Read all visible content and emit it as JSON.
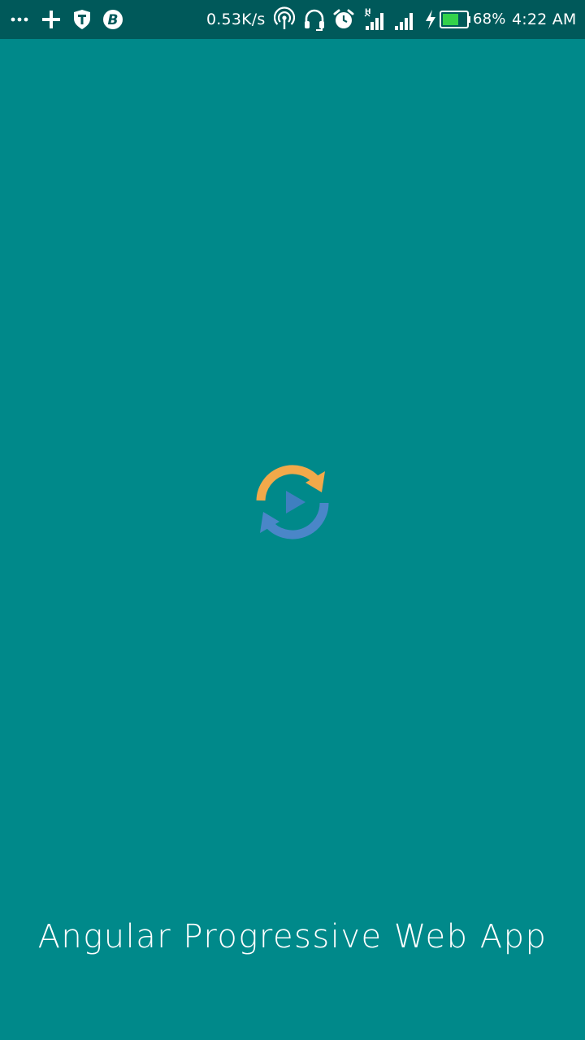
{
  "status_bar": {
    "network_speed": "0.53K/s",
    "battery_percent": "68%",
    "battery_level": 0.68,
    "time": "4:22 AM",
    "network_type": "H",
    "colors": {
      "background": "#00595a",
      "battery_fill": "#34d24a"
    },
    "left_icons": [
      "more-dots-icon",
      "plus-icon",
      "shield-icon",
      "bitcoin-icon"
    ],
    "right_icons": [
      "hotspot-icon",
      "headphones-icon",
      "alarm-icon",
      "signal-1-icon",
      "signal-2-icon",
      "charging-icon",
      "battery-icon"
    ]
  },
  "splash": {
    "title": "Angular Progressive Web App",
    "background": "#00898a",
    "logo": {
      "icon": "sync-play-logo-icon",
      "colors": {
        "top_arrow": "#f2a94a",
        "bottom_arrow": "#4a86c8",
        "play": "#3f7fc0"
      }
    }
  }
}
